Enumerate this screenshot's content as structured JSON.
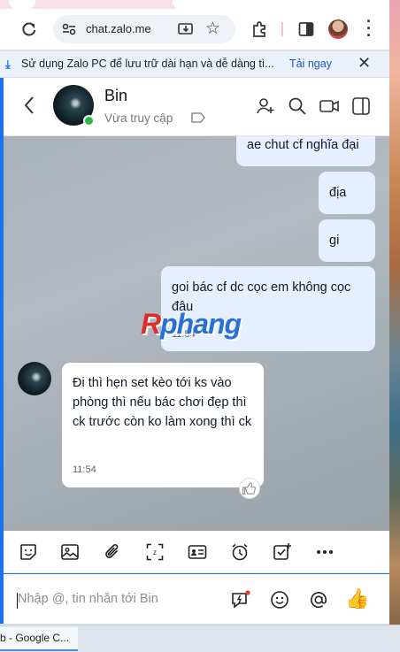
{
  "browser": {
    "url": "chat.zalo.me",
    "info_bar": {
      "message": "Sử dụng Zalo PC để lưu trữ dài hạn và dễ dàng tì...",
      "action": "Tải ngay"
    }
  },
  "chat": {
    "contact_name": "Bin",
    "status": "Vừa truy cập",
    "messages": [
      {
        "dir": "out",
        "text": "ae chut cf nghĩa đại"
      },
      {
        "dir": "out",
        "text": "địa"
      },
      {
        "dir": "out",
        "text": "gi"
      },
      {
        "dir": "out",
        "text": "goi bác cf dc cọc em không cọc đâu",
        "time": "11:54"
      },
      {
        "dir": "in",
        "text": "Đi thì hẹn set kèo tới ks vào phòng thì nếu bác chơi đẹp thì ck trước còn ko làm xong thì ck",
        "time": "11:54"
      }
    ],
    "watermark": {
      "part1": "R",
      "part2": "phang"
    }
  },
  "composer": {
    "placeholder": "Nhập @, tin nhắn tới Bin",
    "send_emoji": "👍"
  },
  "taskbar": {
    "item": "b - Google C..."
  },
  "colors": {
    "accent": "#1a73e8",
    "outgoing_bubble": "#e5efff",
    "online": "#2bbb4a"
  }
}
